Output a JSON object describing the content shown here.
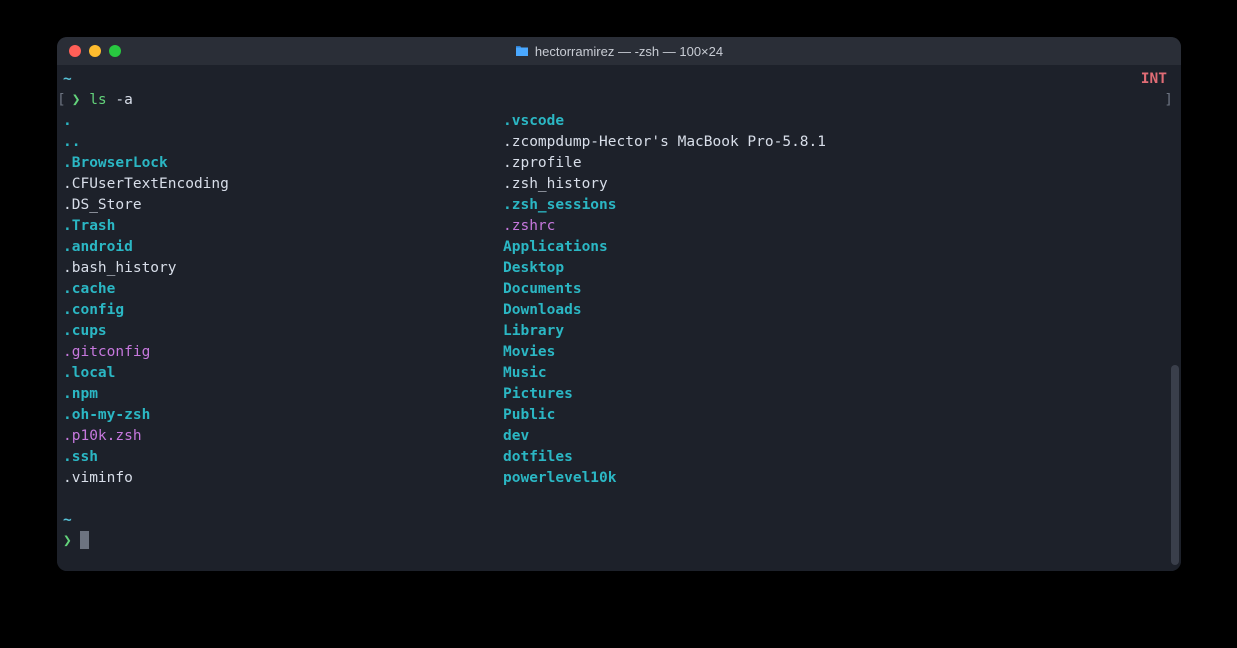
{
  "titlebar": {
    "title": "hectorramirez — -zsh — 100×24"
  },
  "status": {
    "int": "INT"
  },
  "prompt": {
    "tilde": "~",
    "arrow": "❯",
    "command": "ls",
    "arg": "-a",
    "bracket_l": "[",
    "bracket_r": "]"
  },
  "listing": {
    "col1": [
      {
        "text": ".",
        "kind": "dir"
      },
      {
        "text": "..",
        "kind": "dir"
      },
      {
        "text": ".BrowserLock",
        "kind": "dir"
      },
      {
        "text": ".CFUserTextEncoding",
        "kind": "file"
      },
      {
        "text": ".DS_Store",
        "kind": "file"
      },
      {
        "text": ".Trash",
        "kind": "dir"
      },
      {
        "text": ".android",
        "kind": "dir"
      },
      {
        "text": ".bash_history",
        "kind": "file"
      },
      {
        "text": ".cache",
        "kind": "dir"
      },
      {
        "text": ".config",
        "kind": "dir"
      },
      {
        "text": ".cups",
        "kind": "dir"
      },
      {
        "text": ".gitconfig",
        "kind": "link"
      },
      {
        "text": ".local",
        "kind": "dir"
      },
      {
        "text": ".npm",
        "kind": "dir"
      },
      {
        "text": ".oh-my-zsh",
        "kind": "dir"
      },
      {
        "text": ".p10k.zsh",
        "kind": "link"
      },
      {
        "text": ".ssh",
        "kind": "dir"
      },
      {
        "text": ".viminfo",
        "kind": "file"
      }
    ],
    "col2": [
      {
        "text": ".vscode",
        "kind": "dir"
      },
      {
        "text": ".zcompdump-Hector's MacBook Pro-5.8.1",
        "kind": "file"
      },
      {
        "text": ".zprofile",
        "kind": "file"
      },
      {
        "text": ".zsh_history",
        "kind": "file"
      },
      {
        "text": ".zsh_sessions",
        "kind": "dir"
      },
      {
        "text": ".zshrc",
        "kind": "link"
      },
      {
        "text": "Applications",
        "kind": "dir"
      },
      {
        "text": "Desktop",
        "kind": "dir"
      },
      {
        "text": "Documents",
        "kind": "dir"
      },
      {
        "text": "Downloads",
        "kind": "dir"
      },
      {
        "text": "Library",
        "kind": "dir"
      },
      {
        "text": "Movies",
        "kind": "dir"
      },
      {
        "text": "Music",
        "kind": "dir"
      },
      {
        "text": "Pictures",
        "kind": "dir"
      },
      {
        "text": "Public",
        "kind": "dir"
      },
      {
        "text": "dev",
        "kind": "dir"
      },
      {
        "text": "dotfiles",
        "kind": "dir"
      },
      {
        "text": "powerlevel10k",
        "kind": "dir"
      }
    ]
  }
}
